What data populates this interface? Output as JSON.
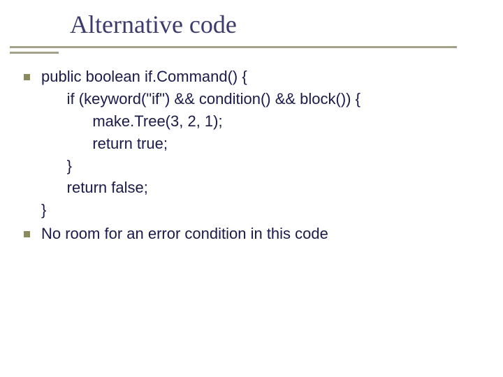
{
  "title": "Alternative code",
  "code": {
    "l1": "public boolean if.Command() {",
    "l2": "      if (keyword(\"if\") && condition() && block()) {",
    "l3": "            make.Tree(3, 2, 1);",
    "l4": "            return true;",
    "l5": "      }",
    "l6": "      return false;",
    "l7": "}"
  },
  "note": "No room for an error condition in this code"
}
